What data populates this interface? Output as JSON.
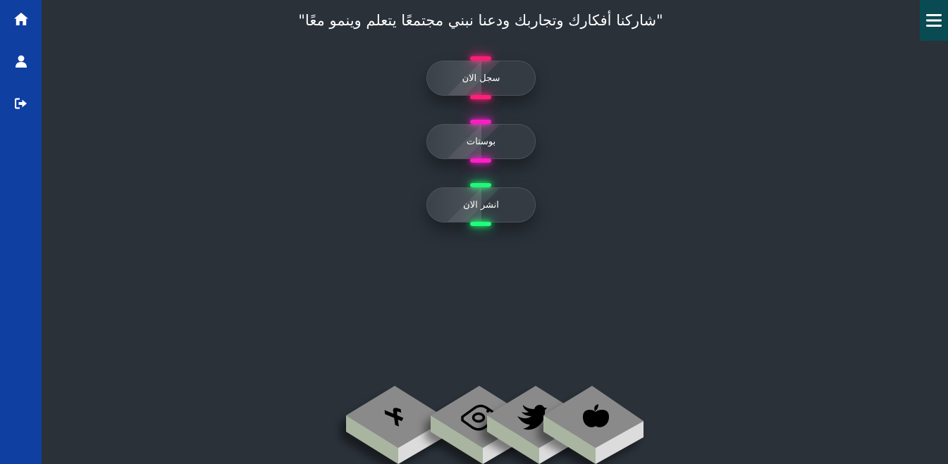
{
  "sidebar": {
    "items": [
      {
        "icon": "home-icon"
      },
      {
        "icon": "user-icon"
      },
      {
        "icon": "logout-icon"
      }
    ]
  },
  "header": {
    "menu_icon": "hamburger-menu-icon",
    "quote": "\"شاركنا أفكارك وتجاربك ودعنا نبني مجتمعًا يتعلم وينمو معًا\""
  },
  "actions": {
    "register_label": "سجل الان",
    "posts_label": "بوستات",
    "publish_label": "انشر الان"
  },
  "colors": {
    "sidebar_bg": "#0f3fa0",
    "page_bg": "#2a3139",
    "menu_bg": "#0a4a52",
    "register_glow": "#ff1f7a",
    "posts_glow": "#ff1fc8",
    "publish_glow": "#1fff7a"
  },
  "social": {
    "tiles": [
      {
        "icon": "facebook-icon"
      },
      {
        "icon": "instagram-icon"
      },
      {
        "icon": "twitter-icon"
      },
      {
        "icon": "apple-icon"
      }
    ]
  }
}
